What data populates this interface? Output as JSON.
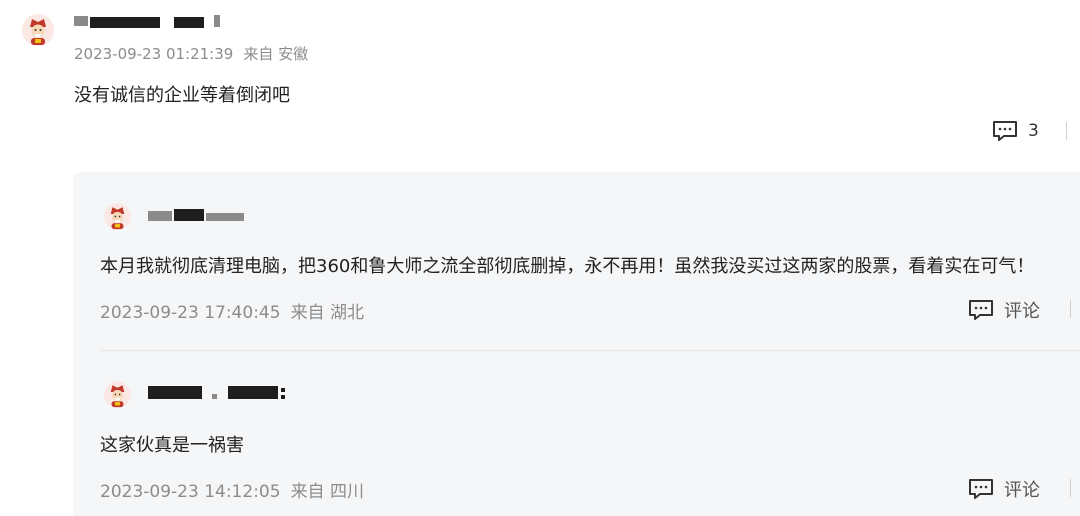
{
  "comment": {
    "timestamp": "2023-09-23 01:21:39",
    "location": "来自 安徽",
    "text": "没有诚信的企业等着倒闭吧",
    "reply_count": "3",
    "avatar_icon": "avatar-god-of-wealth-icon",
    "action_icon": "comment-bubble-icon"
  },
  "replies": [
    {
      "text": "本月我就彻底清理电脑，把360和鲁大师之流全部彻底删掉，永不再用！虽然我没买过这两家的股票，看着实在可气！",
      "timestamp": "2023-09-23 17:40:45",
      "location": "来自 湖北",
      "action_label": "评论"
    },
    {
      "text": "这家伙真是一祸害",
      "timestamp": "2023-09-23 14:12:05",
      "location": "来自 四川",
      "action_label": "评论"
    }
  ],
  "colors": {
    "panel_bg": "#f5f6f8",
    "meta_text": "#8c8c8c",
    "body_text": "#222222"
  }
}
